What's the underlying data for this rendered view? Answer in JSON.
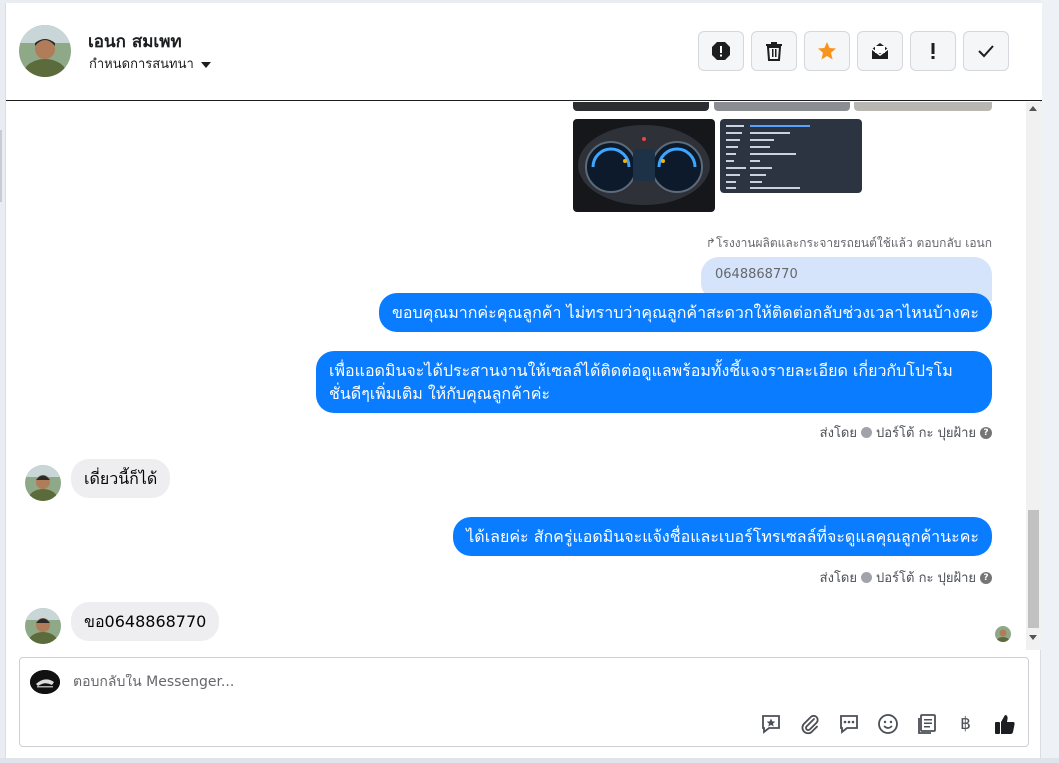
{
  "header": {
    "contact_name": "เอนก สมเพท",
    "conversation_settings": "กำหนดการสนทนา",
    "toolbar": [
      "report-spam",
      "delete",
      "star",
      "mark-unread",
      "important",
      "done"
    ]
  },
  "conversation": {
    "reply_meta": "โรงงานผลิตและกระจายรถยนต์ใช้แล้ว ตอบกลับ เอนก",
    "quoted_text": "0648868770",
    "messages": [
      {
        "side": "out",
        "text": "ขอบคุณมากค่ะคุณลูกค้า ไม่ทราบว่าคุณลูกค้าสะดวกให้ติดต่อกลับช่วงเวลาไหนบ้างคะ"
      },
      {
        "side": "out",
        "line1": "เพื่อแอดมินจะได้ประสานงานให้เซลล์ได้ติดต่อดูแลพร้อมทั้งชี้แจงรายละเอียด เกี่ยวกับโปรโม",
        "line2": "ชั่นดีๆเพิ่มเติม ให้กับคุณลูกค้าค่ะ"
      },
      {
        "side": "in",
        "text": "เดี่ยวนี้ก็ได้"
      },
      {
        "side": "out",
        "text": "ได้เลยค่ะ สักครู่แอดมินจะแจ้งชื่อและเบอร์โทรเซลล์ที่จะดูแลคุณลูกค้านะคะ"
      },
      {
        "side": "in",
        "text": "ขอ0648868770"
      }
    ],
    "sent_by": {
      "prefix": "ส่งโดย",
      "name": "ปอร์โต้ กะ ปุยฝ้าย"
    }
  },
  "composer": {
    "placeholder": "ตอบกลับใน Messenger...",
    "baht_symbol": "฿"
  },
  "colors": {
    "outgoing": "#0a7cff",
    "incoming": "#eeeef0",
    "star": "#f7931e"
  }
}
